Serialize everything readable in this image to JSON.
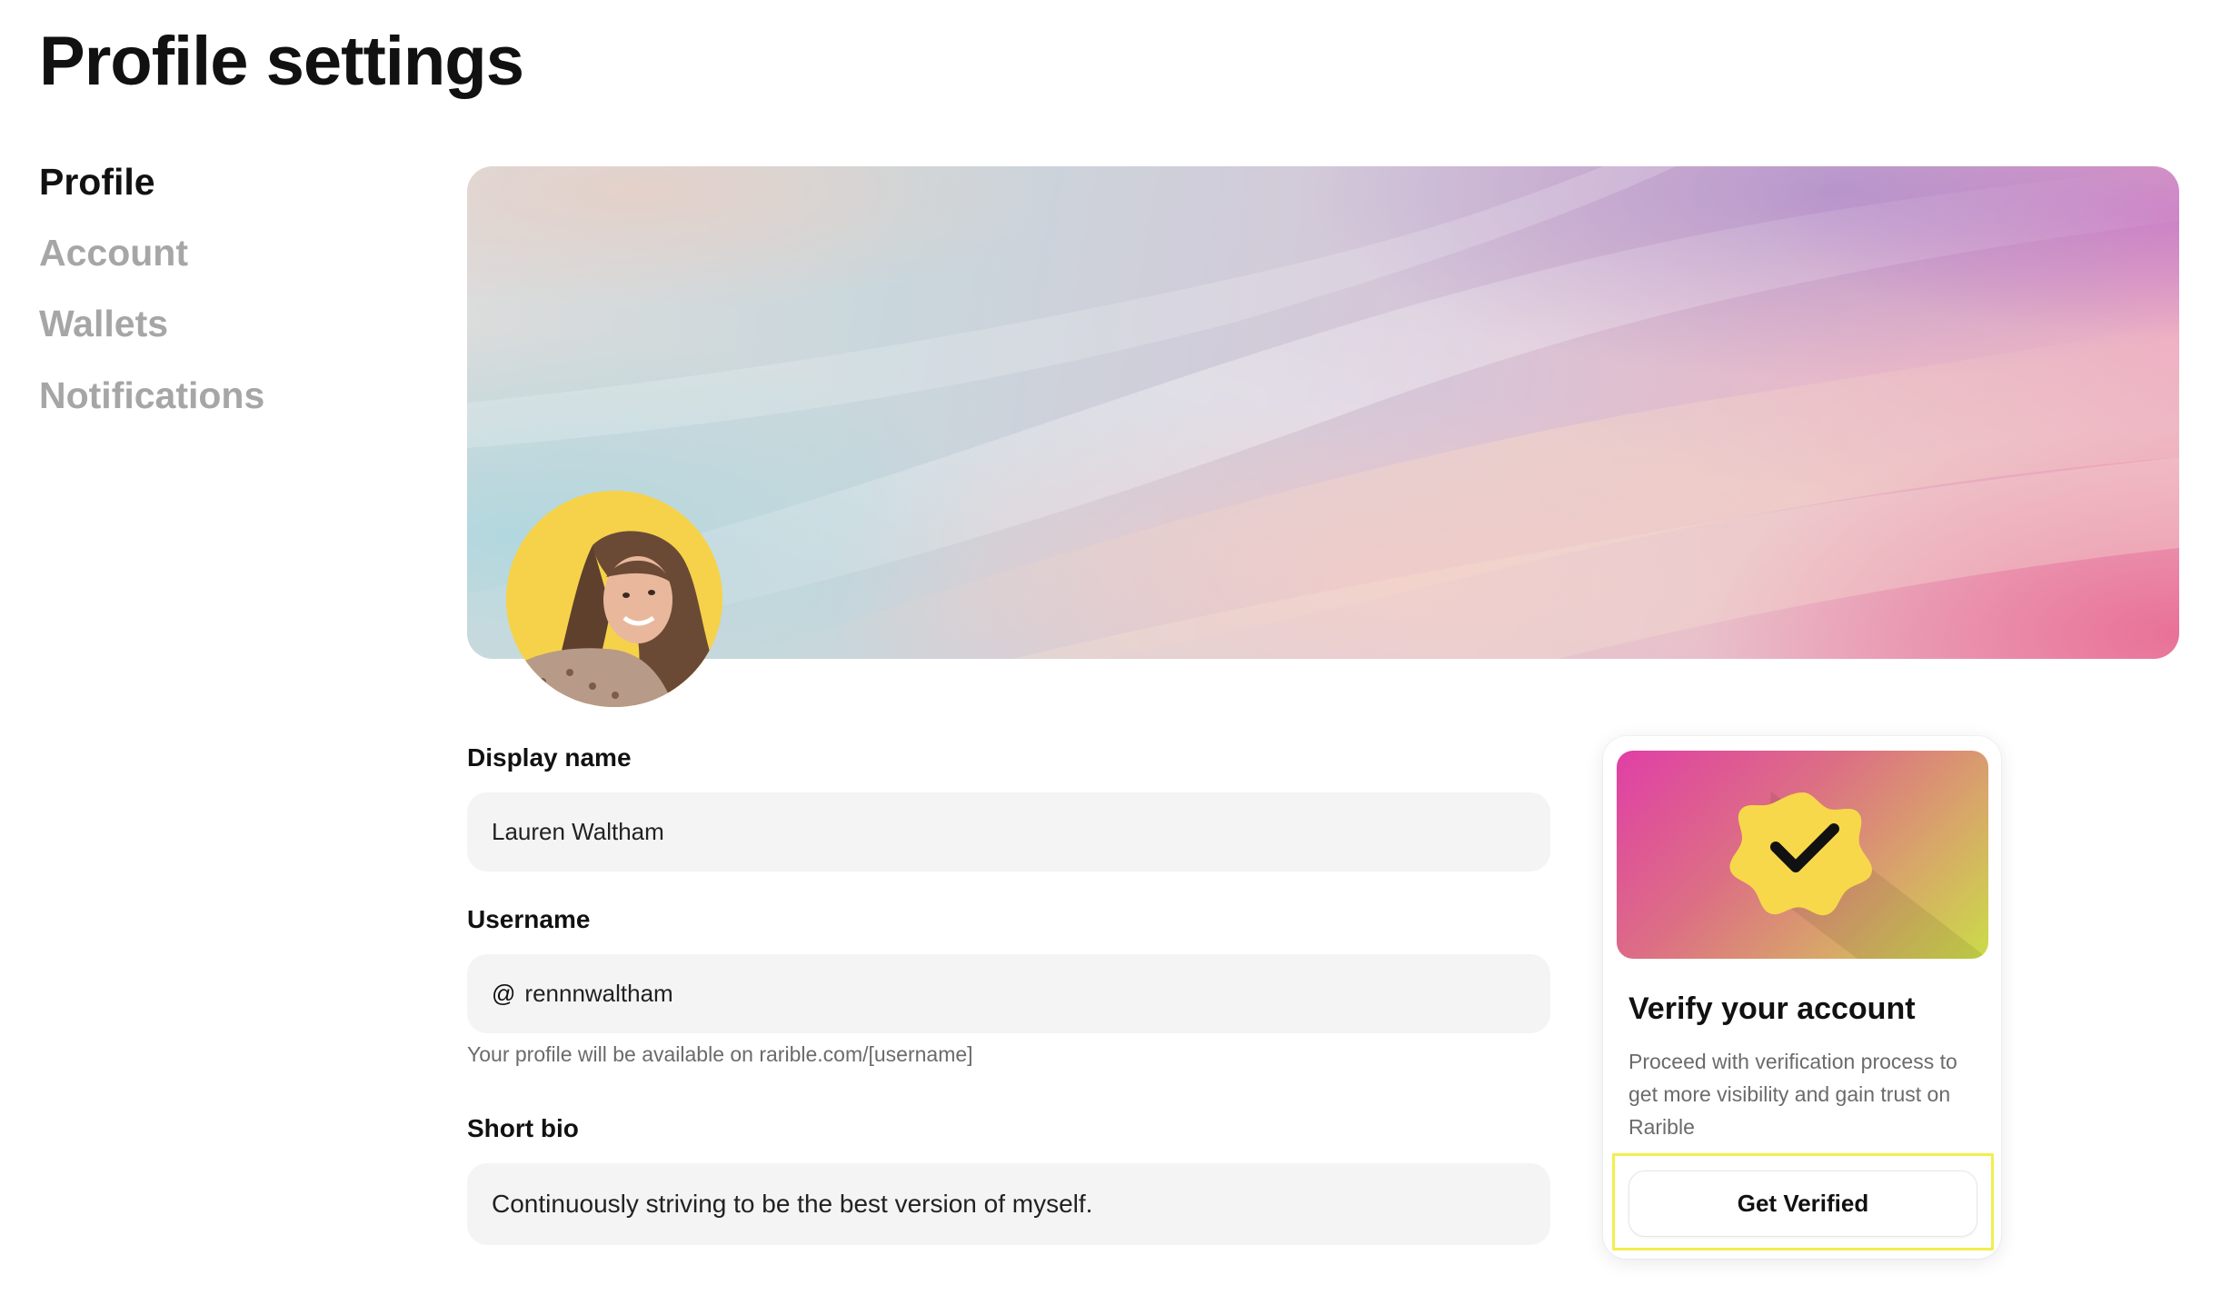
{
  "page": {
    "title": "Profile settings"
  },
  "sidebar": {
    "items": [
      {
        "label": "Profile",
        "active": true
      },
      {
        "label": "Account",
        "active": false
      },
      {
        "label": "Wallets",
        "active": false
      },
      {
        "label": "Notifications",
        "active": false
      }
    ]
  },
  "profile_form": {
    "display_name": {
      "label": "Display name",
      "value": "Lauren Waltham"
    },
    "username": {
      "label": "Username",
      "prefix": "@",
      "value": "rennnwaltham",
      "helper": "Your profile will be available on rarible.com/[username]"
    },
    "short_bio": {
      "label": "Short bio",
      "value": "Continuously striving to be the best version of myself."
    }
  },
  "verify_card": {
    "title": "Verify your account",
    "description": "Proceed with verification process to get more visibility and gain trust on Rarible",
    "button_label": "Get Verified",
    "icon": "verified-badge-icon",
    "highlight_color": "#f2ee4e"
  },
  "colors": {
    "text_primary": "#111111",
    "text_muted": "#a6a6a6",
    "input_bg": "#f4f4f4",
    "avatar_bg": "#f6d24a",
    "badge_color": "#f7d84b"
  }
}
